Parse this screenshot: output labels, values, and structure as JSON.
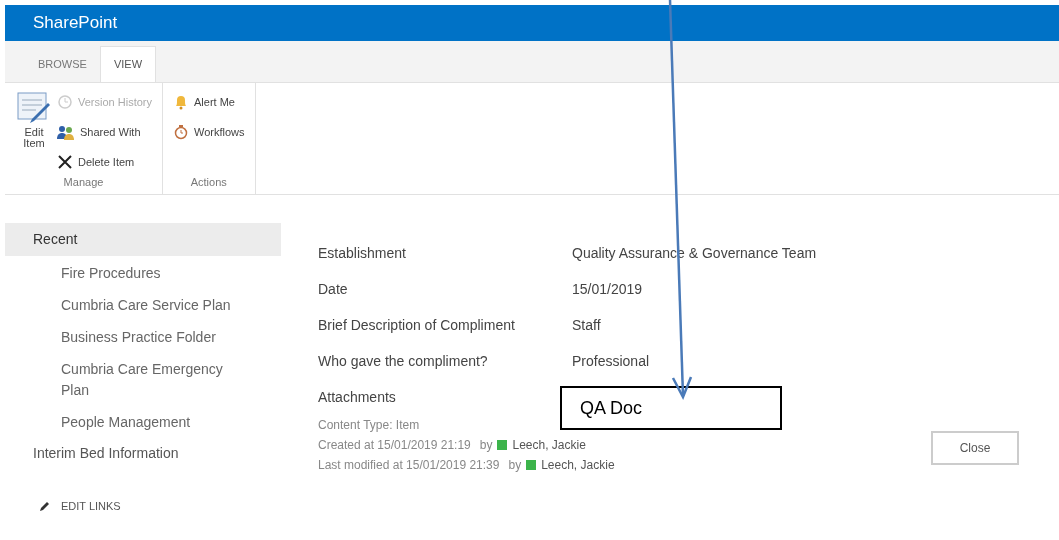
{
  "suite_bar": {
    "title": "SharePoint"
  },
  "ribbon_tabs": [
    {
      "label": "BROWSE",
      "selected": false
    },
    {
      "label": "VIEW",
      "selected": true
    }
  ],
  "ribbon_groups": [
    {
      "label": "Manage",
      "large_button": {
        "label": "Edit Item"
      },
      "buttons": [
        {
          "label": "Version History",
          "disabled": true
        },
        {
          "label": "Shared With",
          "disabled": false
        },
        {
          "label": "Delete Item",
          "disabled": false
        }
      ]
    },
    {
      "label": "Actions",
      "buttons": [
        {
          "label": "Alert Me",
          "disabled": false
        },
        {
          "label": "Workflows",
          "disabled": false
        }
      ]
    }
  ],
  "sidebar": {
    "items": [
      {
        "label": "Recent",
        "selected": true,
        "children": [
          {
            "label": "Fire Procedures"
          },
          {
            "label": "Cumbria Care Service Plan"
          },
          {
            "label": "Business Practice Folder"
          },
          {
            "label": "Cumbria Care Emergency Plan"
          },
          {
            "label": "People Management"
          }
        ]
      },
      {
        "label": "Interim Bed Information",
        "selected": false
      }
    ],
    "edit_links": "EDIT LINKS"
  },
  "fields": [
    {
      "label": "Establishment",
      "value": "Quality Assurance & Governance Team"
    },
    {
      "label": "Date",
      "value": "15/01/2019"
    },
    {
      "label": "Brief Description of Compliment",
      "value": "Staff"
    },
    {
      "label": "Who gave the compliment?",
      "value": "Professional"
    },
    {
      "label": "Attachments"
    }
  ],
  "footer": {
    "content_type": "Content Type: Item",
    "lines": [
      {
        "text": "Created at 15/01/2019 21:19",
        "by": "by",
        "user": "Leech, Jackie",
        "color": "#3cb44b"
      },
      {
        "text": "Last modified at 15/01/2019 21:39",
        "by": "by",
        "user": "Leech, Jackie",
        "color": "#3cb44b"
      }
    ]
  },
  "close_button": "Close",
  "annotation": {
    "callout": "QA Doc"
  }
}
